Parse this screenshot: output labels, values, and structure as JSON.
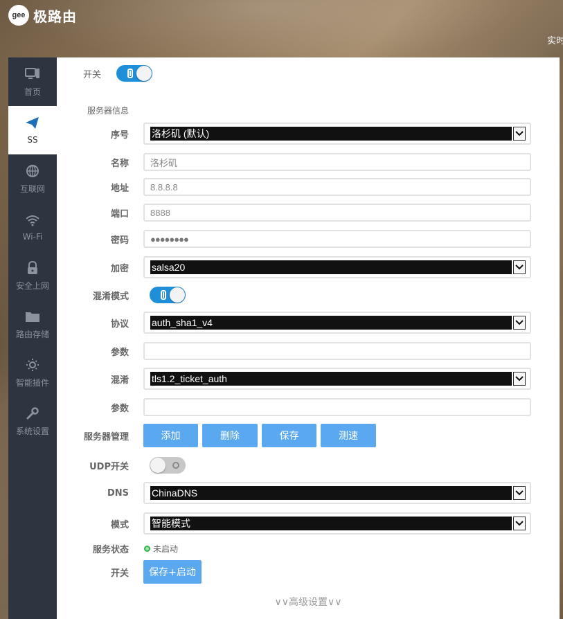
{
  "app": {
    "logo_mark": "gee",
    "title": "极路由",
    "top_right_text": "实时"
  },
  "sidebar": {
    "items": [
      {
        "label": "首页",
        "icon": "monitor-icon",
        "active": false
      },
      {
        "label": "SS",
        "icon": "paper-plane-icon",
        "active": true
      },
      {
        "label": "互联网",
        "icon": "globe-icon",
        "active": false
      },
      {
        "label": "Wi-Fi",
        "icon": "wifi-icon",
        "active": false
      },
      {
        "label": "安全上网",
        "icon": "lock-icon",
        "active": false
      },
      {
        "label": "路由存储",
        "icon": "folder-icon",
        "active": false
      },
      {
        "label": "智能插件",
        "icon": "sun-icon",
        "active": false
      },
      {
        "label": "系统设置",
        "icon": "wrench-icon",
        "active": false
      }
    ]
  },
  "form": {
    "master_switch": {
      "label": "开关",
      "on": true
    },
    "section_title": "服务器信息",
    "server_index": {
      "label": "序号",
      "value": "洛杉矶 (默认)"
    },
    "name": {
      "label": "名称",
      "value": "洛杉矶"
    },
    "address": {
      "label": "地址",
      "value": "8.8.8.8"
    },
    "port": {
      "label": "端口",
      "value": "8888"
    },
    "password": {
      "label": "密码",
      "value": "●●●●●●●●"
    },
    "encryption": {
      "label": "加密",
      "value": "salsa20"
    },
    "obfs_mode": {
      "label": "混淆模式",
      "on": true
    },
    "protocol": {
      "label": "协议",
      "value": "auth_sha1_v4"
    },
    "protocol_param": {
      "label": "参数",
      "value": ""
    },
    "obfs": {
      "label": "混淆",
      "value": "tls1.2_ticket_auth"
    },
    "obfs_param": {
      "label": "参数",
      "value": ""
    },
    "server_mgmt": {
      "label": "服务器管理",
      "buttons": {
        "add": "添加",
        "delete": "删除",
        "save": "保存",
        "speedtest": "测速"
      }
    },
    "udp_switch": {
      "label": "UDP开关",
      "on": false
    },
    "dns": {
      "label": "DNS",
      "value": "ChinaDNS"
    },
    "mode": {
      "label": "模式",
      "value": "智能模式"
    },
    "service_status": {
      "label": "服务状态",
      "value": "未启动",
      "color": "#2db34a"
    },
    "start_switch": {
      "label": "开关",
      "button": "保存+启动"
    },
    "advanced_link": "∨∨高级设置∨∨"
  },
  "colors": {
    "accent": "#1e8fd8",
    "button": "#5aa8ef",
    "sidebar_bg": "#2e3540"
  }
}
